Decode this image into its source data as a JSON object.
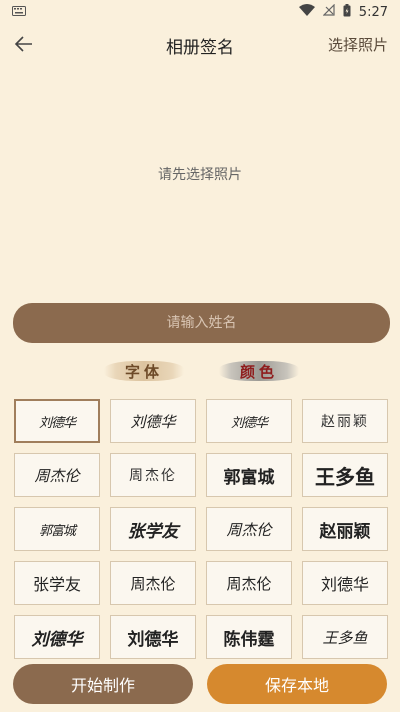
{
  "status_bar": {
    "left_icon": "keyboard-icon",
    "time": "5:27",
    "icons": [
      "wifi-icon",
      "signal-off-icon",
      "battery-icon"
    ]
  },
  "header": {
    "back_icon": "arrow-left-icon",
    "title": "相册签名",
    "select_photo": "选择照片"
  },
  "photo_area": {
    "hint": "请先选择照片"
  },
  "name_input": {
    "placeholder": "请输入姓名",
    "value": ""
  },
  "tabs": [
    {
      "label": "字体",
      "selected": false
    },
    {
      "label": "颜色",
      "selected": false
    }
  ],
  "signatures": [
    {
      "text": "刘德华",
      "style": "s-a",
      "selected": true
    },
    {
      "text": "刘德华",
      "style": "s-b",
      "selected": false
    },
    {
      "text": "刘德华",
      "style": "s-a",
      "selected": false
    },
    {
      "text": "赵丽颖",
      "style": "s-c",
      "selected": false
    },
    {
      "text": "周杰伦",
      "style": "s-b",
      "selected": false
    },
    {
      "text": "周杰伦",
      "style": "s-c",
      "selected": false
    },
    {
      "text": "郭富城",
      "style": "s-d",
      "selected": false
    },
    {
      "text": "王多鱼",
      "style": "s-e",
      "selected": false
    },
    {
      "text": "郭富城",
      "style": "s-a",
      "selected": false
    },
    {
      "text": "张学友",
      "style": "s-h",
      "selected": false
    },
    {
      "text": "周杰伦",
      "style": "s-b",
      "selected": false
    },
    {
      "text": "赵丽颖",
      "style": "s-d",
      "selected": false
    },
    {
      "text": "张学友",
      "style": "s-g",
      "selected": false
    },
    {
      "text": "周杰伦",
      "style": "s-f",
      "selected": false
    },
    {
      "text": "周杰伦",
      "style": "s-f",
      "selected": false
    },
    {
      "text": "刘德华",
      "style": "s-g",
      "selected": false
    },
    {
      "text": "刘德华",
      "style": "s-h",
      "selected": false
    },
    {
      "text": "刘德华",
      "style": "s-d",
      "selected": false
    },
    {
      "text": "陈伟霆",
      "style": "s-d",
      "selected": false
    },
    {
      "text": "王多鱼",
      "style": "s-b",
      "selected": false
    }
  ],
  "buttons": {
    "make": "开始制作",
    "save": "保存本地"
  },
  "colors": {
    "background": "#faf0dc",
    "primary_brown": "#8b6a4e",
    "accent_orange": "#d6892e",
    "color_tab_red": "#8f1d1d"
  }
}
